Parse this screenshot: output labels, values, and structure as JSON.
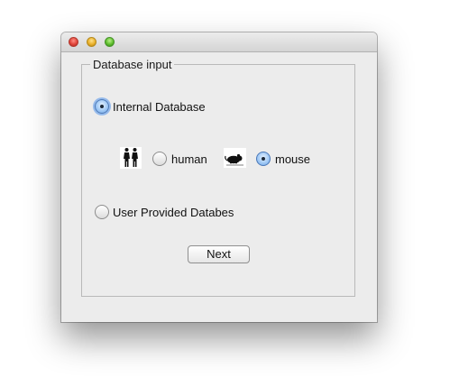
{
  "window": {
    "buttons": {
      "close": "close-icon",
      "minimize": "minimize-icon",
      "zoom": "zoom-icon"
    }
  },
  "group": {
    "title": "Database input"
  },
  "internal_db": {
    "label": "Internal Database",
    "selected": true
  },
  "organisms": {
    "human": {
      "label": "human",
      "icon": "human-figures-icon",
      "selected": false
    },
    "mouse": {
      "label": "mouse",
      "icon": "mouse-icon",
      "selected": true
    }
  },
  "user_db": {
    "label": "User Provided Databes",
    "selected": false
  },
  "actions": {
    "next_label": "Next"
  }
}
